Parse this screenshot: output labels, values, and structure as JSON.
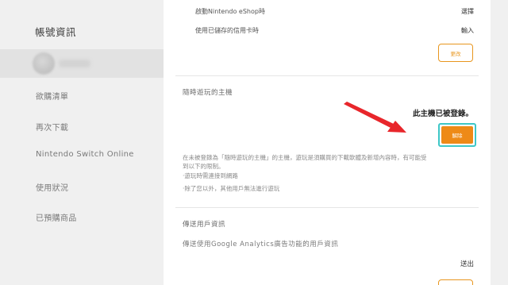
{
  "sidebar": {
    "title": "帳號資訊",
    "items": [
      {
        "label": "欲購清單"
      },
      {
        "label": "再次下載"
      },
      {
        "label": "Nintendo Switch Online"
      },
      {
        "label": "使用狀況"
      },
      {
        "label": "已預購商品"
      }
    ]
  },
  "main": {
    "payment_rows": [
      {
        "label": "啟動Nintendo eShop時",
        "value": "選擇"
      },
      {
        "label": "使用已儲存的信用卡時",
        "value": "輸入"
      }
    ],
    "change_button": "更改",
    "console_section": {
      "title": "隨時遊玩的主機",
      "status": "此主機已被登錄。",
      "deregister_button": "解除",
      "description": [
        "在未被登錄為「隨時遊玩的主機」的主機，遊玩是須購買的下載軟體及新增內容時，有可能受",
        "到以下的限制。",
        "·遊玩時需連接到網路",
        "·除了您以外，其他用戶無法進行遊玩"
      ]
    },
    "analytics_section": {
      "title": "傳送用戶資訊",
      "description": "傳送使用Google Analytics廣告功能的用戶資訊",
      "value": "送出"
    }
  },
  "colors": {
    "accent": "#ee8a17",
    "highlight": "#3ec7c7",
    "arrow": "#e8262b"
  }
}
